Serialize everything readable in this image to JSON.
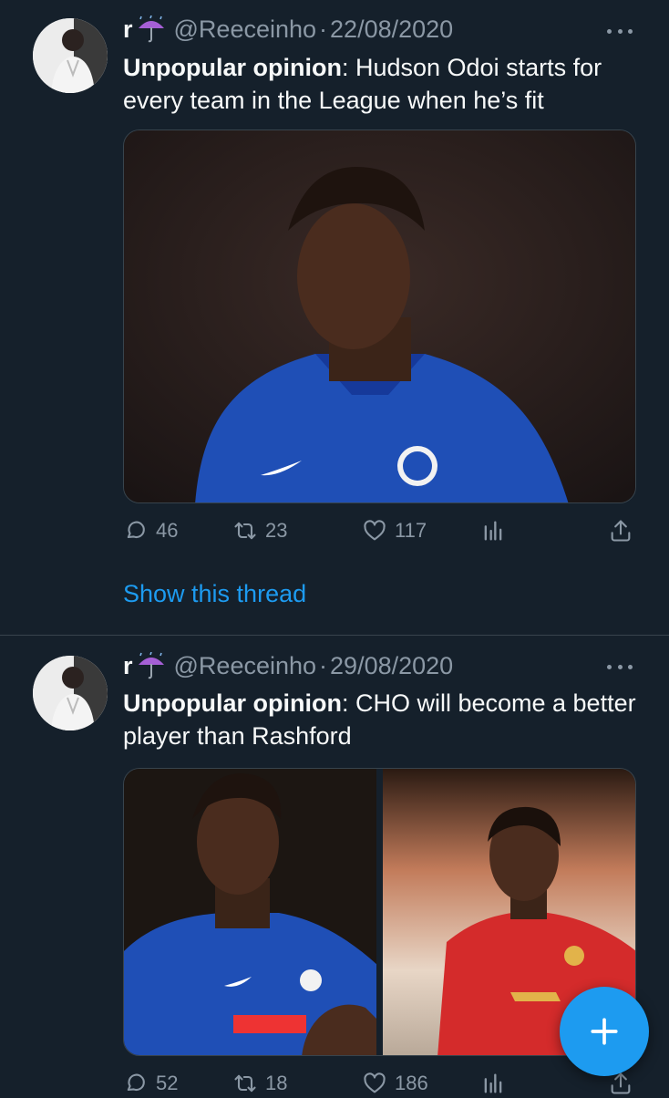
{
  "tweets": [
    {
      "name": "r",
      "handle": "@Reeceinho",
      "separator": "·",
      "date": "22/08/2020",
      "text_bold": "Unpopular opinion",
      "text_rest": ": Hudson Odoi starts for every team in the League when he’s fit",
      "replies": "46",
      "retweets": "23",
      "likes": "117",
      "show_thread": "Show this thread"
    },
    {
      "name": "r",
      "handle": "@Reeceinho",
      "separator": "·",
      "date": "29/08/2020",
      "text_bold": "Unpopular opinion",
      "text_rest": ": CHO will become a better player than Rashford",
      "replies": "52",
      "retweets": "18",
      "likes": "186"
    }
  ],
  "icons": {
    "name_emoji": "umbrella-rain-icon",
    "more": "more-horizontal-icon",
    "reply": "reply-icon",
    "retweet": "retweet-icon",
    "like": "heart-icon",
    "views": "analytics-icon",
    "share": "share-icon",
    "compose": "plus-icon"
  },
  "colors": {
    "background": "#15202b",
    "accent": "#1d9bf0",
    "secondary_text": "#8b98a5",
    "divider": "#38444d"
  }
}
